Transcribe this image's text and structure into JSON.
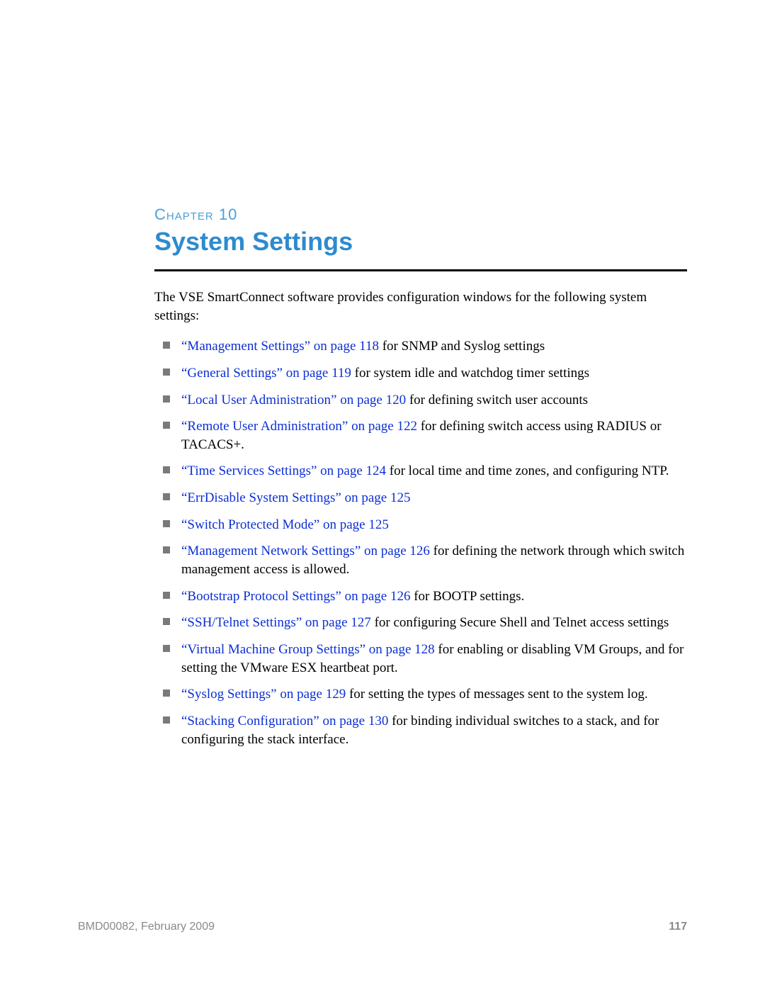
{
  "header": {
    "chapter_label": "Chapter 10",
    "chapter_title": "System Settings"
  },
  "intro": "The VSE SmartConnect software provides configuration windows for the following system settings:",
  "items": [
    {
      "link": "“Management Settings” on page 118",
      "tail": " for SNMP and Syslog settings"
    },
    {
      "link": "“General Settings” on page 119",
      "tail": " for system idle and watchdog timer settings"
    },
    {
      "link": "“Local User Administration” on page 120",
      "tail": " for defining switch user accounts"
    },
    {
      "link": "“Remote User Administration” on page 122",
      "tail": " for defining switch access using RADIUS or TACACS+."
    },
    {
      "link": "“Time Services Settings” on page 124",
      "tail": " for local time and time zones, and configuring NTP."
    },
    {
      "link": "“ErrDisable System Settings” on page 125",
      "tail": ""
    },
    {
      "link": "“Switch Protected Mode” on page 125",
      "tail": ""
    },
    {
      "link": "“Management Network Settings” on page 126",
      "tail": " for defining the network through which switch management access is allowed."
    },
    {
      "link": "“Bootstrap Protocol Settings” on page 126",
      "tail": " for BOOTP settings."
    },
    {
      "link": "“SSH/Telnet Settings” on page 127",
      "tail": " for configuring Secure Shell and Telnet access settings"
    },
    {
      "link": "“Virtual Machine Group Settings” on page 128",
      "tail": " for enabling or disabling VM Groups, and for setting the VMware ESX heartbeat port."
    },
    {
      "link": "“Syslog Settings” on page 129",
      "tail": " for setting the types of messages sent to the system log."
    },
    {
      "link": "“Stacking Configuration” on page 130",
      "tail": " for binding individual switches to a stack, and for configuring the stack interface."
    }
  ],
  "footer": {
    "doc_id": "BMD00082, February 2009",
    "page_number": "117"
  }
}
